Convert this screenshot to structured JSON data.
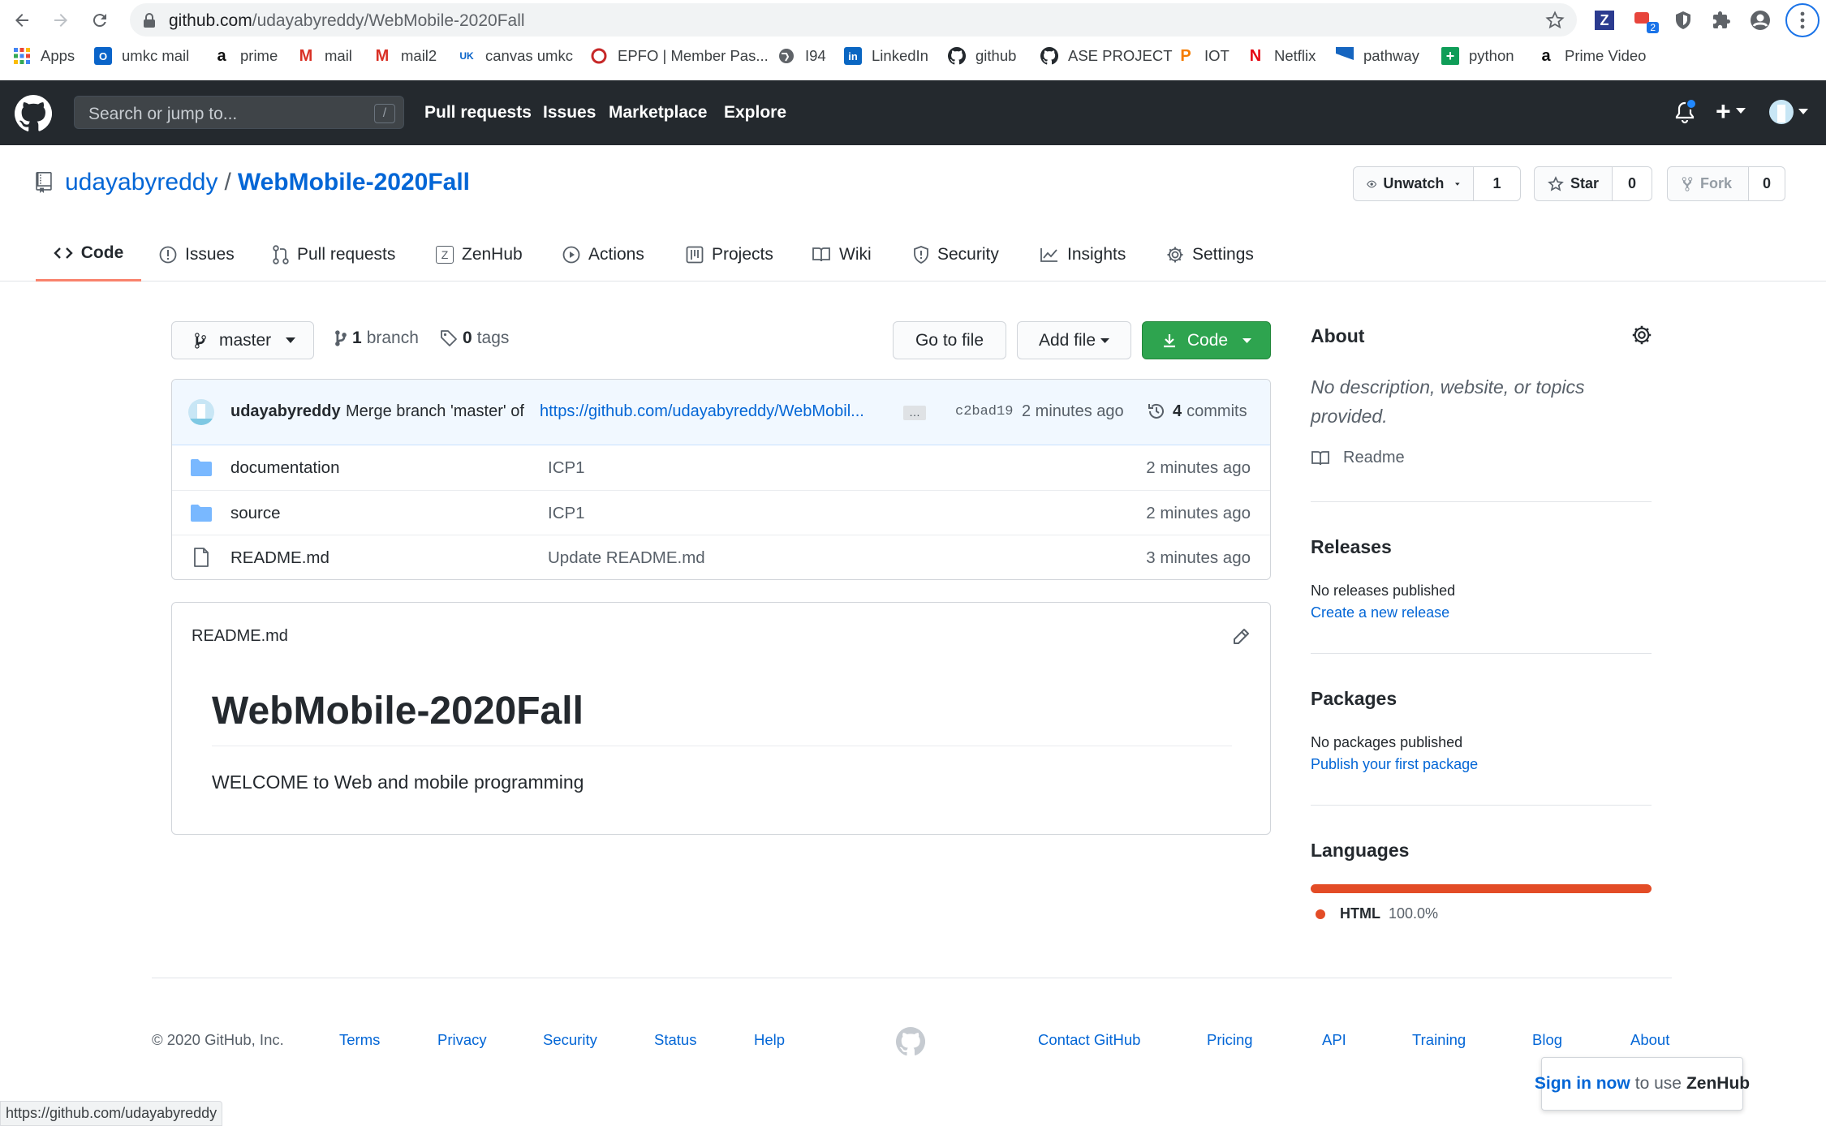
{
  "browser": {
    "url_host": "github.com",
    "url_path": "/udayabyreddy/WebMobile-2020Fall",
    "ext_badge": "2",
    "bookmarks": [
      "Apps",
      "umkc mail",
      "prime",
      "mail",
      "mail2",
      "canvas umkc",
      "EPFO | Member Pas...",
      "I94",
      "LinkedIn",
      "github",
      "ASE PROJECT",
      "IOT",
      "Netflix",
      "pathway",
      "python",
      "Prime Video"
    ],
    "status_url": "https://github.com/udayabyreddy"
  },
  "header": {
    "search_placeholder": "Search or jump to...",
    "search_key": "/",
    "nav": [
      "Pull requests",
      "Issues",
      "Marketplace",
      "Explore"
    ],
    "plus": "+"
  },
  "repo": {
    "owner": "udayabyreddy",
    "separator": "/",
    "name": "WebMobile-2020Fall",
    "unwatch_label": "Unwatch",
    "watch_count": "1",
    "star_label": "Star",
    "star_count": "0",
    "fork_label": "Fork",
    "fork_count": "0"
  },
  "tabs": [
    "Code",
    "Issues",
    "Pull requests",
    "ZenHub",
    "Actions",
    "Projects",
    "Wiki",
    "Security",
    "Insights",
    "Settings"
  ],
  "toolbar": {
    "branch": "master",
    "branch_count": "1",
    "branch_word": "branch",
    "tag_count": "0",
    "tag_word": "tags",
    "goto_file": "Go to file",
    "add_file": "Add file",
    "code": "Code"
  },
  "commit": {
    "author": "udayabyreddy",
    "message": "Merge branch 'master' of",
    "link": "https://github.com/udayabyreddy/WebMobil...",
    "ellipsis": "…",
    "sha": "c2bad19",
    "time": "2 minutes ago",
    "commit_count": "4",
    "commit_word": "commits"
  },
  "files": [
    {
      "name": "documentation",
      "type": "folder",
      "message": "ICP1",
      "time": "2 minutes ago"
    },
    {
      "name": "source",
      "type": "folder",
      "message": "ICP1",
      "time": "2 minutes ago"
    },
    {
      "name": "README.md",
      "type": "file",
      "message": "Update README.md",
      "time": "3 minutes ago"
    }
  ],
  "readme": {
    "filename": "README.md",
    "heading": "WebMobile-2020Fall",
    "body": "WELCOME to Web and mobile programming"
  },
  "sidebar": {
    "about_title": "About",
    "about_desc": "No description, website, or topics provided.",
    "readme_label": "Readme",
    "releases_title": "Releases",
    "releases_none": "No releases published",
    "releases_link": "Create a new release",
    "packages_title": "Packages",
    "packages_none": "No packages published",
    "packages_link": "Publish your first package",
    "languages_title": "Languages",
    "language_name": "HTML",
    "language_pct": "100.0%",
    "language_color": "#e34c26"
  },
  "footer": {
    "copyright": "© 2020 GitHub, Inc.",
    "left_links": [
      "Terms",
      "Privacy",
      "Security",
      "Status",
      "Help"
    ],
    "right_links": [
      "Contact GitHub",
      "Pricing",
      "API",
      "Training",
      "Blog",
      "About"
    ]
  },
  "zenhub": {
    "link": "Sign in now",
    "middle": "to use",
    "brand": "ZenHub"
  }
}
